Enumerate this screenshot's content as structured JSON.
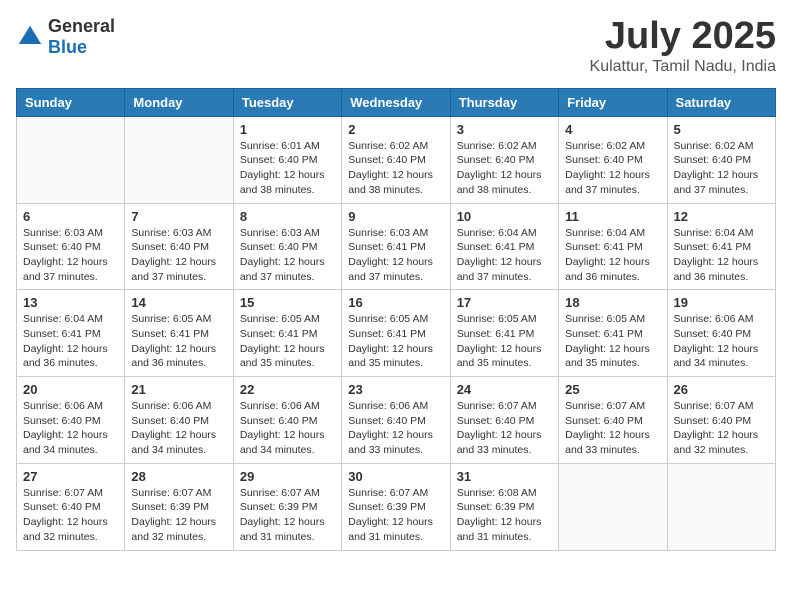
{
  "logo": {
    "general": "General",
    "blue": "Blue"
  },
  "header": {
    "month": "July 2025",
    "location": "Kulattur, Tamil Nadu, India"
  },
  "weekdays": [
    "Sunday",
    "Monday",
    "Tuesday",
    "Wednesday",
    "Thursday",
    "Friday",
    "Saturday"
  ],
  "weeks": [
    [
      {
        "day": "",
        "sunrise": "",
        "sunset": "",
        "daylight": ""
      },
      {
        "day": "",
        "sunrise": "",
        "sunset": "",
        "daylight": ""
      },
      {
        "day": "1",
        "sunrise": "Sunrise: 6:01 AM",
        "sunset": "Sunset: 6:40 PM",
        "daylight": "Daylight: 12 hours and 38 minutes."
      },
      {
        "day": "2",
        "sunrise": "Sunrise: 6:02 AM",
        "sunset": "Sunset: 6:40 PM",
        "daylight": "Daylight: 12 hours and 38 minutes."
      },
      {
        "day": "3",
        "sunrise": "Sunrise: 6:02 AM",
        "sunset": "Sunset: 6:40 PM",
        "daylight": "Daylight: 12 hours and 38 minutes."
      },
      {
        "day": "4",
        "sunrise": "Sunrise: 6:02 AM",
        "sunset": "Sunset: 6:40 PM",
        "daylight": "Daylight: 12 hours and 37 minutes."
      },
      {
        "day": "5",
        "sunrise": "Sunrise: 6:02 AM",
        "sunset": "Sunset: 6:40 PM",
        "daylight": "Daylight: 12 hours and 37 minutes."
      }
    ],
    [
      {
        "day": "6",
        "sunrise": "Sunrise: 6:03 AM",
        "sunset": "Sunset: 6:40 PM",
        "daylight": "Daylight: 12 hours and 37 minutes."
      },
      {
        "day": "7",
        "sunrise": "Sunrise: 6:03 AM",
        "sunset": "Sunset: 6:40 PM",
        "daylight": "Daylight: 12 hours and 37 minutes."
      },
      {
        "day": "8",
        "sunrise": "Sunrise: 6:03 AM",
        "sunset": "Sunset: 6:40 PM",
        "daylight": "Daylight: 12 hours and 37 minutes."
      },
      {
        "day": "9",
        "sunrise": "Sunrise: 6:03 AM",
        "sunset": "Sunset: 6:41 PM",
        "daylight": "Daylight: 12 hours and 37 minutes."
      },
      {
        "day": "10",
        "sunrise": "Sunrise: 6:04 AM",
        "sunset": "Sunset: 6:41 PM",
        "daylight": "Daylight: 12 hours and 37 minutes."
      },
      {
        "day": "11",
        "sunrise": "Sunrise: 6:04 AM",
        "sunset": "Sunset: 6:41 PM",
        "daylight": "Daylight: 12 hours and 36 minutes."
      },
      {
        "day": "12",
        "sunrise": "Sunrise: 6:04 AM",
        "sunset": "Sunset: 6:41 PM",
        "daylight": "Daylight: 12 hours and 36 minutes."
      }
    ],
    [
      {
        "day": "13",
        "sunrise": "Sunrise: 6:04 AM",
        "sunset": "Sunset: 6:41 PM",
        "daylight": "Daylight: 12 hours and 36 minutes."
      },
      {
        "day": "14",
        "sunrise": "Sunrise: 6:05 AM",
        "sunset": "Sunset: 6:41 PM",
        "daylight": "Daylight: 12 hours and 36 minutes."
      },
      {
        "day": "15",
        "sunrise": "Sunrise: 6:05 AM",
        "sunset": "Sunset: 6:41 PM",
        "daylight": "Daylight: 12 hours and 35 minutes."
      },
      {
        "day": "16",
        "sunrise": "Sunrise: 6:05 AM",
        "sunset": "Sunset: 6:41 PM",
        "daylight": "Daylight: 12 hours and 35 minutes."
      },
      {
        "day": "17",
        "sunrise": "Sunrise: 6:05 AM",
        "sunset": "Sunset: 6:41 PM",
        "daylight": "Daylight: 12 hours and 35 minutes."
      },
      {
        "day": "18",
        "sunrise": "Sunrise: 6:05 AM",
        "sunset": "Sunset: 6:41 PM",
        "daylight": "Daylight: 12 hours and 35 minutes."
      },
      {
        "day": "19",
        "sunrise": "Sunrise: 6:06 AM",
        "sunset": "Sunset: 6:40 PM",
        "daylight": "Daylight: 12 hours and 34 minutes."
      }
    ],
    [
      {
        "day": "20",
        "sunrise": "Sunrise: 6:06 AM",
        "sunset": "Sunset: 6:40 PM",
        "daylight": "Daylight: 12 hours and 34 minutes."
      },
      {
        "day": "21",
        "sunrise": "Sunrise: 6:06 AM",
        "sunset": "Sunset: 6:40 PM",
        "daylight": "Daylight: 12 hours and 34 minutes."
      },
      {
        "day": "22",
        "sunrise": "Sunrise: 6:06 AM",
        "sunset": "Sunset: 6:40 PM",
        "daylight": "Daylight: 12 hours and 34 minutes."
      },
      {
        "day": "23",
        "sunrise": "Sunrise: 6:06 AM",
        "sunset": "Sunset: 6:40 PM",
        "daylight": "Daylight: 12 hours and 33 minutes."
      },
      {
        "day": "24",
        "sunrise": "Sunrise: 6:07 AM",
        "sunset": "Sunset: 6:40 PM",
        "daylight": "Daylight: 12 hours and 33 minutes."
      },
      {
        "day": "25",
        "sunrise": "Sunrise: 6:07 AM",
        "sunset": "Sunset: 6:40 PM",
        "daylight": "Daylight: 12 hours and 33 minutes."
      },
      {
        "day": "26",
        "sunrise": "Sunrise: 6:07 AM",
        "sunset": "Sunset: 6:40 PM",
        "daylight": "Daylight: 12 hours and 32 minutes."
      }
    ],
    [
      {
        "day": "27",
        "sunrise": "Sunrise: 6:07 AM",
        "sunset": "Sunset: 6:40 PM",
        "daylight": "Daylight: 12 hours and 32 minutes."
      },
      {
        "day": "28",
        "sunrise": "Sunrise: 6:07 AM",
        "sunset": "Sunset: 6:39 PM",
        "daylight": "Daylight: 12 hours and 32 minutes."
      },
      {
        "day": "29",
        "sunrise": "Sunrise: 6:07 AM",
        "sunset": "Sunset: 6:39 PM",
        "daylight": "Daylight: 12 hours and 31 minutes."
      },
      {
        "day": "30",
        "sunrise": "Sunrise: 6:07 AM",
        "sunset": "Sunset: 6:39 PM",
        "daylight": "Daylight: 12 hours and 31 minutes."
      },
      {
        "day": "31",
        "sunrise": "Sunrise: 6:08 AM",
        "sunset": "Sunset: 6:39 PM",
        "daylight": "Daylight: 12 hours and 31 minutes."
      },
      {
        "day": "",
        "sunrise": "",
        "sunset": "",
        "daylight": ""
      },
      {
        "day": "",
        "sunrise": "",
        "sunset": "",
        "daylight": ""
      }
    ]
  ]
}
